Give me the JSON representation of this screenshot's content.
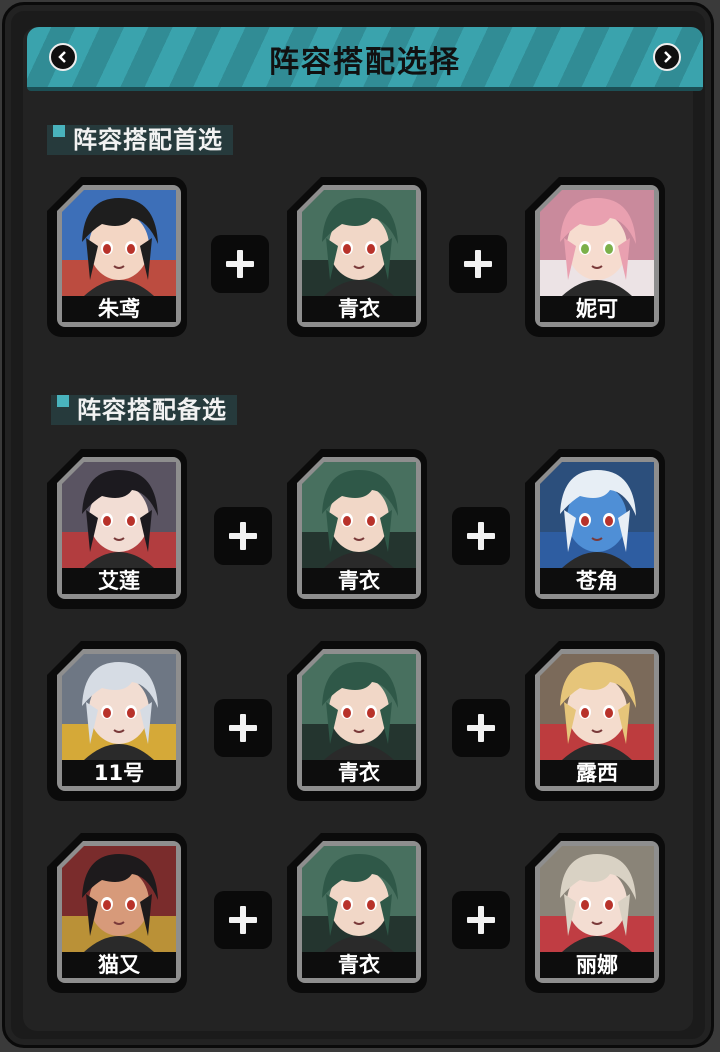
{
  "header": {
    "title": "阵容搭配选择"
  },
  "sections": [
    {
      "title": "阵容搭配首选",
      "rows": [
        {
          "members": [
            {
              "name": "朱鸢",
              "hair": "#1e1e1e",
              "skin": "#f3d6c4",
              "accent": "#d2462a",
              "bg": "#3d6fb8"
            },
            {
              "name": "青衣",
              "hair": "#2f5848",
              "skin": "#f1d7c7",
              "accent": "#1f2a27",
              "bg": "#48705f"
            },
            {
              "name": "妮可",
              "hair": "#e9a0b0",
              "skin": "#f6dccf",
              "accent": "#f2f2f2",
              "bg": "#c98a9c"
            }
          ]
        }
      ]
    },
    {
      "title": "阵容搭配备选",
      "rows": [
        {
          "members": [
            {
              "name": "艾莲",
              "hair": "#1c1a1f",
              "skin": "#f2ddd4",
              "accent": "#c23a3a",
              "bg": "#5a5462"
            },
            {
              "name": "青衣",
              "hair": "#2f5848",
              "skin": "#f1d7c7",
              "accent": "#1f2a27",
              "bg": "#48705f"
            },
            {
              "name": "苍角",
              "hair": "#e7eef5",
              "skin": "#4f8fd6",
              "accent": "#2f5fa8",
              "bg": "#2c4f7c"
            }
          ]
        },
        {
          "members": [
            {
              "name": "11号",
              "hair": "#d6dce4",
              "skin": "#f2ddd2",
              "accent": "#e8b22a",
              "bg": "#6e7784"
            },
            {
              "name": "青衣",
              "hair": "#2f5848",
              "skin": "#f1d7c7",
              "accent": "#1f2a27",
              "bg": "#48705f"
            },
            {
              "name": "露西",
              "hair": "#e6c57a",
              "skin": "#f4dccd",
              "accent": "#c9343a",
              "bg": "#7b6a5a"
            }
          ]
        },
        {
          "members": [
            {
              "name": "猫又",
              "hair": "#1d1a1c",
              "skin": "#d79a7a",
              "accent": "#c6a33a",
              "bg": "#7a2c2c"
            },
            {
              "name": "青衣",
              "hair": "#2f5848",
              "skin": "#f1d7c7",
              "accent": "#1f2a27",
              "bg": "#48705f"
            },
            {
              "name": "丽娜",
              "hair": "#d9d2c4",
              "skin": "#f3ddd2",
              "accent": "#c9303a",
              "bg": "#8a8478"
            }
          ]
        }
      ]
    }
  ],
  "colors": {
    "accent": "#3aa3ad",
    "panel": "#1b1b1b"
  }
}
